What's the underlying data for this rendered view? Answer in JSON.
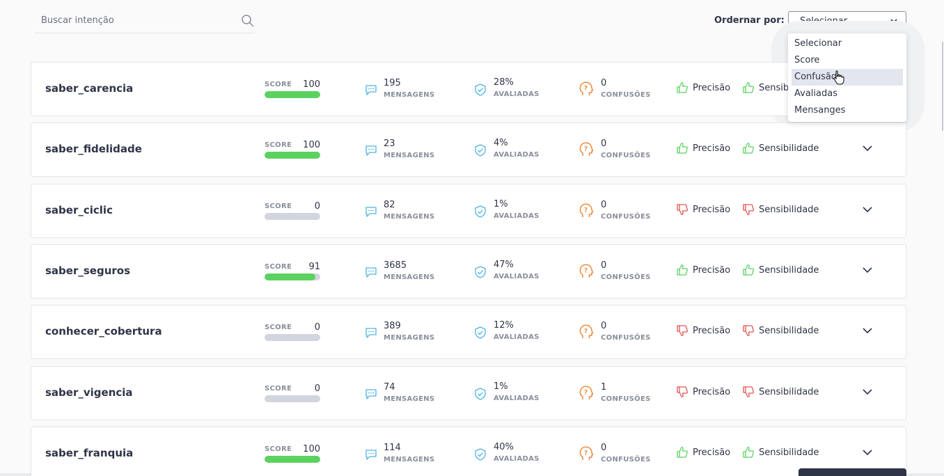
{
  "search": {
    "placeholder": "Buscar intenção"
  },
  "sort": {
    "label": "Ordernar por:",
    "selected": "Selecionar",
    "options": [
      "Selecionar",
      "Score",
      "Confusão",
      "Avaliadas",
      "Mensanges"
    ],
    "hovered_index": 2
  },
  "labels": {
    "score": "SCORE",
    "messages": "MENSAGENS",
    "rated": "AVALIADAS",
    "confusions": "CONFUSÕES",
    "precision": "Precisão",
    "sensitivity": "Sensibilidade"
  },
  "colors": {
    "good": "#5bd25f",
    "bad": "#e2544f",
    "accent": "#4fb3e0",
    "warning": "#ef8a3c"
  },
  "intents": [
    {
      "name": "saber_carencia",
      "score": "100",
      "score_fraction": 1.0,
      "messages": "195",
      "rated": "28%",
      "confusions": "0",
      "precision": "up",
      "sensitivity": "up"
    },
    {
      "name": "saber_fidelidade",
      "score": "100",
      "score_fraction": 1.0,
      "messages": "23",
      "rated": "4%",
      "confusions": "0",
      "precision": "up",
      "sensitivity": "up"
    },
    {
      "name": "saber_ciclic",
      "score": "0",
      "score_fraction": 0.0,
      "messages": "82",
      "rated": "1%",
      "confusions": "0",
      "precision": "down",
      "sensitivity": "down"
    },
    {
      "name": "saber_seguros",
      "score": "91",
      "score_fraction": 0.91,
      "messages": "3685",
      "rated": "47%",
      "confusions": "0",
      "precision": "up",
      "sensitivity": "up"
    },
    {
      "name": "conhecer_cobertura",
      "score": "0",
      "score_fraction": 0.0,
      "messages": "389",
      "rated": "12%",
      "confusions": "0",
      "precision": "down",
      "sensitivity": "down"
    },
    {
      "name": "saber_vigencia",
      "score": "0",
      "score_fraction": 0.0,
      "messages": "74",
      "rated": "1%",
      "confusions": "1",
      "precision": "down",
      "sensitivity": "down"
    },
    {
      "name": "saber_franquia",
      "score": "100",
      "score_fraction": 1.0,
      "messages": "114",
      "rated": "40%",
      "confusions": "0",
      "precision": "up",
      "sensitivity": "up"
    }
  ]
}
